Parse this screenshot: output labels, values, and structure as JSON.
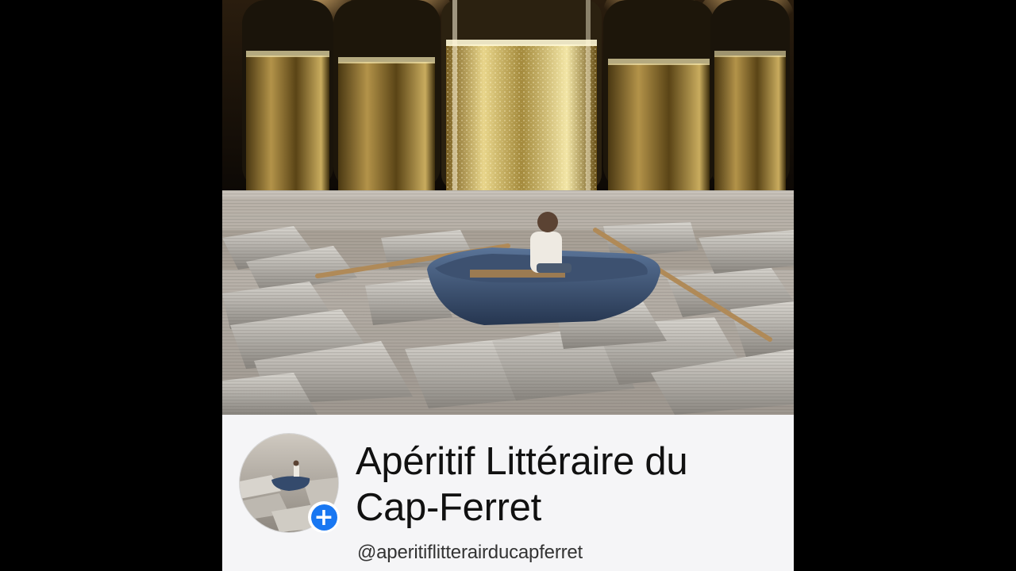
{
  "page": {
    "title": "Apéritif Littéraire du Cap-Ferret",
    "handle": "@aperitiflitterairducapferret"
  },
  "images": {
    "cover_top": "champagne-glasses-photo",
    "cover_bottom": "boy-rowing-boat-on-sea-of-books",
    "avatar": "boy-rowing-boat-on-sea-of-books"
  },
  "colors": {
    "background": "#000000",
    "card": "#f5f5f7",
    "badge": "#1877f2"
  }
}
